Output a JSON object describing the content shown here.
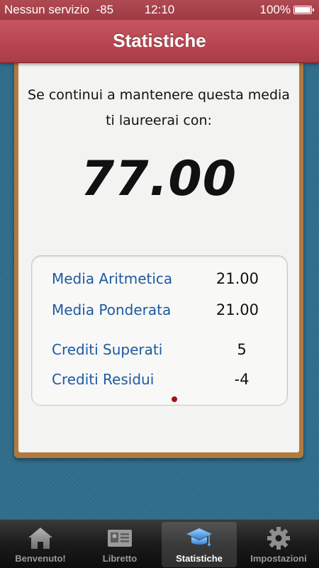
{
  "status_bar": {
    "carrier": "Nessun servizio",
    "signal": "-85",
    "time": "12:10",
    "battery": "100%"
  },
  "nav": {
    "title": "Statistiche"
  },
  "prediction": {
    "line1": "Se continui a mantenere questa media",
    "line2": "ti laureerai con:",
    "grade": "77.00"
  },
  "stats": [
    {
      "label": "Media Aritmetica",
      "value": "21.00"
    },
    {
      "label": "Media Ponderata",
      "value": "21.00"
    },
    {
      "label": "Crediti Superati",
      "value": "5"
    },
    {
      "label": "Crediti Residui",
      "value": "-4"
    }
  ],
  "tabs": [
    {
      "label": "Benvenuto!",
      "icon": "home-icon",
      "active": false
    },
    {
      "label": "Libretto",
      "icon": "id-card-icon",
      "active": false
    },
    {
      "label": "Statistiche",
      "icon": "graduation-cap-icon",
      "active": true
    },
    {
      "label": "Impostazioni",
      "icon": "gear-icon",
      "active": false
    }
  ],
  "colors": {
    "nav_bar": "#b84650",
    "label_blue": "#1e5aa0",
    "background_blue": "#2e6d8c"
  }
}
